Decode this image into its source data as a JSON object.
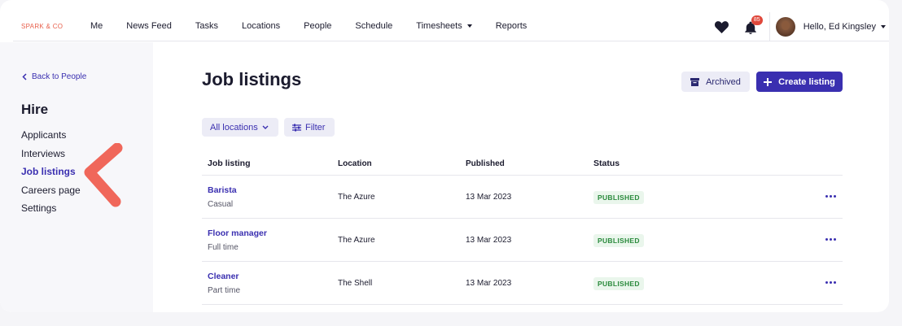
{
  "brand": "SPARK & CO",
  "nav": {
    "items": [
      "Me",
      "News Feed",
      "Tasks",
      "Locations",
      "People",
      "Schedule",
      "Timesheets",
      "Reports"
    ],
    "dropdown_item": "Timesheets",
    "notification_count": "85",
    "greeting": "Hello, Ed Kingsley"
  },
  "sidebar": {
    "back_label": "Back to People",
    "section_title": "Hire",
    "items": [
      "Applicants",
      "Interviews",
      "Job listings",
      "Careers page",
      "Settings"
    ],
    "active_item": "Job listings"
  },
  "main": {
    "title": "Job listings",
    "archived_label": "Archived",
    "create_label": "Create listing",
    "filters": {
      "locations_label": "All locations",
      "filter_label": "Filter"
    },
    "table": {
      "headers": [
        "Job listing",
        "Location",
        "Published",
        "Status"
      ],
      "rows": [
        {
          "title": "Barista",
          "type": "Casual",
          "location": "The Azure",
          "published": "13 Mar 2023",
          "status": "PUBLISHED"
        },
        {
          "title": "Floor manager",
          "type": "Full time",
          "location": "The Azure",
          "published": "13 Mar 2023",
          "status": "PUBLISHED"
        },
        {
          "title": "Cleaner",
          "type": "Part time",
          "location": "The Shell",
          "published": "13 Mar 2023",
          "status": "PUBLISHED"
        }
      ]
    }
  },
  "colors": {
    "accent": "#3a2fb0",
    "brand": "#e8604c",
    "published_text": "#2a8a3c",
    "published_bg": "#eaf6ec",
    "annotation_arrow": "#f0675a"
  },
  "icons": {
    "back": "chevron-left-icon",
    "favorites": "heart-icon",
    "notifications": "bell-icon",
    "archive": "archive-box-icon",
    "create": "plus-icon",
    "filter": "sliders-icon",
    "row_menu": "more-horizontal-icon"
  }
}
